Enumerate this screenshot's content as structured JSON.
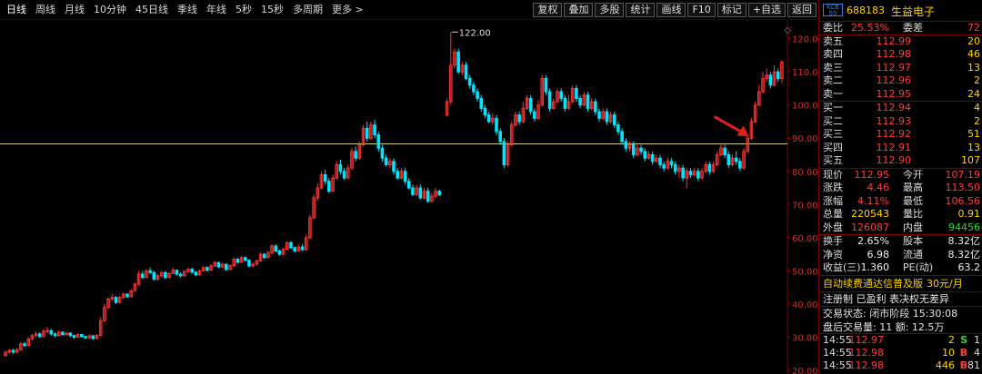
{
  "toolbar": {
    "period_tabs": [
      "日线",
      "周线",
      "月线",
      "10分钟",
      "45日线",
      "季线",
      "年线",
      "5秒",
      "15秒",
      "多周期",
      "更多 >"
    ],
    "active_tab": 0,
    "tools": [
      "复权",
      "叠加",
      "多股",
      "统计",
      "画线",
      "F10",
      "标记",
      "+自选",
      "返回"
    ]
  },
  "stock": {
    "badge": "KCB 50",
    "code": "688183",
    "name": "生益电子"
  },
  "orderbook": {
    "ratio_label": "委比",
    "ratio_value": "25.53%",
    "diff_label": "委差",
    "diff_value": "72",
    "asks": [
      {
        "label": "卖五",
        "price": "112.99",
        "vol": "20"
      },
      {
        "label": "卖四",
        "price": "112.98",
        "vol": "46"
      },
      {
        "label": "卖三",
        "price": "112.97",
        "vol": "13"
      },
      {
        "label": "卖二",
        "price": "112.96",
        "vol": "2"
      },
      {
        "label": "卖一",
        "price": "112.95",
        "vol": "24"
      }
    ],
    "bids": [
      {
        "label": "买一",
        "price": "112.94",
        "vol": "4"
      },
      {
        "label": "买二",
        "price": "112.93",
        "vol": "2"
      },
      {
        "label": "买三",
        "price": "112.92",
        "vol": "51"
      },
      {
        "label": "买四",
        "price": "112.91",
        "vol": "13"
      },
      {
        "label": "买五",
        "price": "112.90",
        "vol": "107"
      }
    ]
  },
  "quote": [
    {
      "l1": "现价",
      "v1": "112.95",
      "c1": "red",
      "l2": "今开",
      "v2": "107.19",
      "c2": "red"
    },
    {
      "l1": "涨跌",
      "v1": "4.46",
      "c1": "red",
      "l2": "最高",
      "v2": "113.50",
      "c2": "red"
    },
    {
      "l1": "涨幅",
      "v1": "4.11%",
      "c1": "red",
      "l2": "最低",
      "v2": "106.56",
      "c2": "red"
    },
    {
      "l1": "总量",
      "v1": "220543",
      "c1": "yellow",
      "l2": "量比",
      "v2": "0.91",
      "c2": "yellow"
    },
    {
      "l1": "外盘",
      "v1": "126087",
      "c1": "red",
      "l2": "内盘",
      "v2": "94456",
      "c2": "green"
    }
  ],
  "fundamentals": [
    {
      "l1": "换手",
      "v1": "2.65%",
      "l2": "股本",
      "v2": "8.32亿"
    },
    {
      "l1": "净资",
      "v1": "6.98",
      "l2": "流通",
      "v2": "8.32亿"
    },
    {
      "l1": "收益(三)",
      "v1": "1.360",
      "l2": "PE(动)",
      "v2": "63.2"
    }
  ],
  "promo": {
    "text": "自动续费通达信普及版",
    "price": "30元/月"
  },
  "reg_line": "注册制 已盈利 表决权无差异",
  "trade_status": "交易状态: 闭市阶段 15:30:08",
  "after_hours": "盘后交易量: 11 额: 12.5万",
  "ticks": [
    {
      "time": "14:55",
      "price": "112.97",
      "vol": "2",
      "bs": "S",
      "bs_color": "green",
      "cnt": "1"
    },
    {
      "time": "14:55",
      "price": "112.98",
      "vol": "10",
      "bs": "B",
      "bs_color": "red",
      "cnt": "4"
    },
    {
      "time": "14:55",
      "price": "112.98",
      "vol": "446",
      "bs": "B",
      "bs_color": "red",
      "cnt": "81"
    }
  ],
  "chart_data": {
    "type": "candlestick",
    "y_ticks": [
      "120.00",
      "110.00",
      "100.00",
      "90.00",
      "80.00",
      "70.00",
      "60.00",
      "50.00",
      "40.00",
      "30.00",
      "20.00"
    ],
    "ylim": [
      20,
      124
    ],
    "max_label": "122.00",
    "hline": 88.3,
    "up_color": "#ff3232",
    "down_color": "#00e4ff",
    "hline_color": "#d4d07a",
    "annotation": "red-arrow",
    "candles": [
      [
        24.5,
        25.5,
        24,
        25.8
      ],
      [
        25.5,
        26,
        25,
        26.5
      ],
      [
        26,
        25.5,
        25,
        26.5
      ],
      [
        25.5,
        26.2,
        25.2,
        26.8
      ],
      [
        26.2,
        28,
        26,
        28.5
      ],
      [
        28,
        27.5,
        27,
        28.6
      ],
      [
        27.5,
        29.5,
        27.2,
        30
      ],
      [
        29.5,
        30.5,
        29,
        31
      ],
      [
        30.5,
        31,
        30,
        31.8
      ],
      [
        31,
        30.2,
        29.8,
        31.5
      ],
      [
        30.2,
        31.8,
        30,
        32.5
      ],
      [
        31.8,
        32,
        31.2,
        33
      ],
      [
        32,
        31,
        30.5,
        32.4
      ],
      [
        31,
        30.5,
        30,
        31.4
      ],
      [
        30.5,
        31.5,
        30.2,
        32
      ],
      [
        31.5,
        30.8,
        30.5,
        31.8
      ],
      [
        30.8,
        31.2,
        30.5,
        31.6
      ],
      [
        31.2,
        30.5,
        30,
        31.5
      ],
      [
        30.5,
        30,
        29.5,
        30.8
      ],
      [
        30,
        30.8,
        29.8,
        31.2
      ],
      [
        30.8,
        30.2,
        29.8,
        31
      ],
      [
        30.2,
        29.8,
        29.4,
        30.5
      ],
      [
        29.8,
        30.4,
        29.5,
        30.8
      ],
      [
        30.4,
        29.6,
        29.2,
        30.6
      ],
      [
        29.6,
        30.5,
        29.4,
        30.9
      ],
      [
        30.5,
        35,
        30.2,
        36
      ],
      [
        35,
        39,
        34.5,
        40
      ],
      [
        39,
        41.5,
        38.5,
        42
      ],
      [
        41.5,
        42,
        41,
        43
      ],
      [
        42,
        40.5,
        40,
        42.4
      ],
      [
        40.5,
        42,
        40.2,
        42.6
      ],
      [
        42,
        43,
        41.5,
        43.5
      ],
      [
        43,
        42.2,
        41.8,
        43.2
      ],
      [
        42.2,
        44,
        42,
        44.5
      ],
      [
        44,
        46,
        43.8,
        46.5
      ],
      [
        46,
        49,
        45.5,
        50
      ],
      [
        49,
        48,
        47.5,
        50
      ],
      [
        48,
        50,
        47.8,
        50.5
      ],
      [
        50,
        49.5,
        49,
        51
      ],
      [
        49.5,
        47.5,
        47,
        50
      ],
      [
        47.5,
        48.5,
        47,
        49
      ],
      [
        48.5,
        49.5,
        48,
        50
      ],
      [
        49.5,
        48,
        47.6,
        50
      ],
      [
        48,
        49.2,
        47.8,
        49.6
      ],
      [
        49.2,
        50.2,
        49,
        51
      ],
      [
        50.2,
        49,
        48.6,
        50.4
      ],
      [
        49,
        48.5,
        48,
        49.5
      ],
      [
        48.5,
        49.8,
        48.2,
        50.2
      ],
      [
        49.8,
        50.5,
        49.4,
        51
      ],
      [
        50.5,
        49.6,
        49.2,
        51
      ],
      [
        49.6,
        48.8,
        48.4,
        50
      ],
      [
        48.8,
        50,
        48.6,
        50.4
      ],
      [
        50,
        51,
        49.8,
        51.5
      ],
      [
        51,
        50.2,
        49.8,
        51.4
      ],
      [
        50.2,
        51.5,
        50,
        52
      ],
      [
        51.5,
        52.5,
        51.2,
        53
      ],
      [
        52.5,
        51.2,
        50.8,
        52.8
      ],
      [
        51.2,
        52,
        50.8,
        52.4
      ],
      [
        52,
        50.4,
        50,
        52.2
      ],
      [
        50.4,
        51.6,
        50.2,
        52
      ],
      [
        51.6,
        53.5,
        51.2,
        54
      ],
      [
        53.5,
        52.6,
        52.2,
        54
      ],
      [
        52.6,
        54,
        52.4,
        54.5
      ],
      [
        54,
        53.2,
        52.8,
        54.4
      ],
      [
        53.2,
        51.5,
        51,
        53.5
      ],
      [
        51.5,
        52,
        51,
        52.6
      ],
      [
        52,
        53,
        51.6,
        53.4
      ],
      [
        53,
        55,
        52.8,
        55.5
      ],
      [
        55,
        54,
        53.6,
        55.4
      ],
      [
        54,
        55.5,
        53.8,
        56
      ],
      [
        55.5,
        57.5,
        55,
        58
      ],
      [
        57.5,
        56,
        55.6,
        58
      ],
      [
        56,
        55,
        54.6,
        56.4
      ],
      [
        55,
        56.5,
        54.8,
        57
      ],
      [
        56.5,
        58.5,
        56,
        59
      ],
      [
        58.5,
        57,
        56.6,
        59
      ],
      [
        57,
        56,
        55.5,
        57.4
      ],
      [
        56,
        57.2,
        55.8,
        57.8
      ],
      [
        57.2,
        56.4,
        56,
        58
      ],
      [
        56.4,
        60,
        56,
        61
      ],
      [
        60,
        66,
        59.5,
        67
      ],
      [
        66,
        72,
        65.5,
        73
      ],
      [
        72,
        75,
        71,
        76.5
      ],
      [
        75,
        79,
        74.5,
        80
      ],
      [
        79,
        77,
        76,
        80.5
      ],
      [
        77,
        74,
        73.5,
        78
      ],
      [
        74,
        78,
        73.8,
        79
      ],
      [
        78,
        82,
        77.5,
        83
      ],
      [
        82,
        80,
        79,
        83.5
      ],
      [
        80,
        78,
        77.5,
        81
      ],
      [
        78,
        81,
        77.8,
        82
      ],
      [
        81,
        86,
        80.5,
        87
      ],
      [
        86,
        84,
        83,
        87.5
      ],
      [
        84,
        88,
        83.5,
        89
      ],
      [
        88,
        93,
        87.5,
        94
      ],
      [
        93,
        90,
        89,
        95
      ],
      [
        90,
        94,
        89.5,
        95
      ],
      [
        94,
        91,
        90,
        95.5
      ],
      [
        91,
        87,
        86,
        92
      ],
      [
        87,
        84,
        83,
        88
      ],
      [
        84,
        82,
        81.5,
        85
      ],
      [
        82,
        83,
        81,
        84
      ],
      [
        83,
        80,
        79,
        84
      ],
      [
        80,
        78,
        77.5,
        81
      ],
      [
        78,
        80,
        77.5,
        81
      ],
      [
        80,
        77,
        76,
        81
      ],
      [
        77,
        75,
        74.5,
        78
      ],
      [
        75,
        73,
        72.5,
        76
      ],
      [
        73,
        75,
        72.5,
        76
      ],
      [
        75,
        72,
        71.5,
        76
      ],
      [
        72,
        74,
        71.5,
        75
      ],
      [
        74,
        71,
        70.5,
        75
      ],
      [
        71,
        72.5,
        70.5,
        73.5
      ],
      [
        72.5,
        74,
        72,
        75
      ],
      [
        74,
        73,
        72.5,
        74.5
      ],
      [
        null,
        null,
        null,
        null
      ],
      [
        97,
        101,
        96.5,
        102
      ],
      [
        101,
        112,
        100,
        122
      ],
      [
        112,
        116,
        111,
        117
      ],
      [
        116,
        110,
        109.5,
        117
      ],
      [
        110,
        112,
        109,
        113
      ],
      [
        112,
        108,
        107.5,
        113
      ],
      [
        108,
        106,
        105,
        109
      ],
      [
        106,
        104,
        103,
        107
      ],
      [
        104,
        102,
        101,
        105
      ],
      [
        102,
        99,
        98,
        103
      ],
      [
        99,
        97,
        96,
        100
      ],
      [
        97,
        95,
        94.5,
        98
      ],
      [
        95,
        96,
        94,
        97.5
      ],
      [
        96,
        92,
        91,
        97
      ],
      [
        92,
        89,
        88,
        93
      ],
      [
        89,
        82,
        81,
        90
      ],
      [
        82,
        88,
        81.5,
        89
      ],
      [
        88,
        94,
        87.5,
        95
      ],
      [
        94,
        97,
        93.5,
        98
      ],
      [
        97,
        95,
        94,
        98
      ],
      [
        95,
        99,
        94.5,
        101
      ],
      [
        99,
        102,
        98.5,
        103
      ],
      [
        102,
        98,
        97,
        103
      ],
      [
        98,
        96,
        95,
        99
      ],
      [
        96,
        100,
        95.5,
        101.5
      ],
      [
        100,
        108,
        99.5,
        109
      ],
      [
        108,
        104,
        103,
        109
      ],
      [
        104,
        99,
        98,
        105
      ],
      [
        99,
        101,
        98.5,
        102
      ],
      [
        101,
        104,
        100.5,
        105
      ],
      [
        104,
        102,
        101,
        105
      ],
      [
        102,
        99,
        98,
        103
      ],
      [
        99,
        101,
        98.5,
        103
      ],
      [
        101,
        105,
        100.5,
        106
      ],
      [
        105,
        102,
        101,
        106
      ],
      [
        102,
        100,
        99,
        103
      ],
      [
        100,
        103,
        99.5,
        104
      ],
      [
        103,
        99,
        98,
        104
      ],
      [
        99,
        101,
        98.5,
        102
      ],
      [
        101,
        98,
        97,
        102
      ],
      [
        98,
        96,
        95,
        99
      ],
      [
        96,
        98,
        95.5,
        99
      ],
      [
        98,
        95,
        94,
        99
      ],
      [
        95,
        97,
        94.5,
        98
      ],
      [
        97,
        94,
        93,
        98
      ],
      [
        94,
        92,
        91,
        95
      ],
      [
        92,
        89,
        88,
        93
      ],
      [
        89,
        87,
        86,
        90
      ],
      [
        87,
        88,
        86,
        89
      ],
      [
        88,
        85,
        84,
        89
      ],
      [
        85,
        87,
        84.5,
        88
      ],
      [
        87,
        86,
        85,
        88
      ],
      [
        86,
        84,
        83,
        87
      ],
      [
        84,
        85,
        83.5,
        86
      ],
      [
        85,
        83,
        82,
        86
      ],
      [
        83,
        84,
        82.5,
        85
      ],
      [
        84,
        82,
        81,
        85
      ],
      [
        82,
        81,
        80,
        83
      ],
      [
        81,
        83,
        80.5,
        84
      ],
      [
        83,
        82,
        81,
        84
      ],
      [
        82,
        80,
        79,
        83
      ],
      [
        80,
        81,
        78,
        82
      ],
      [
        81,
        78,
        77,
        82
      ],
      [
        78,
        80,
        75,
        81
      ],
      [
        80,
        79,
        78,
        81
      ],
      [
        79,
        80,
        78.5,
        81
      ],
      [
        80,
        78,
        77,
        81
      ],
      [
        78,
        80,
        77.5,
        81
      ],
      [
        80,
        82,
        79.5,
        83
      ],
      [
        82,
        80,
        79,
        83
      ],
      [
        80,
        82,
        79.5,
        83
      ],
      [
        82,
        85,
        81.5,
        86
      ],
      [
        85,
        87,
        84.5,
        88
      ],
      [
        87,
        85,
        84,
        88
      ],
      [
        85,
        82,
        81,
        86
      ],
      [
        82,
        84,
        81.5,
        85
      ],
      [
        84,
        83,
        82,
        86
      ],
      [
        83,
        81,
        80,
        84
      ],
      [
        81,
        86,
        80.5,
        87
      ],
      [
        86,
        90,
        85.5,
        91
      ],
      [
        90,
        95,
        89.5,
        96
      ],
      [
        95,
        100,
        94.5,
        101
      ],
      [
        100,
        104,
        99.5,
        106
      ],
      [
        104,
        108,
        103.5,
        110
      ],
      [
        108,
        109,
        107,
        111
      ],
      [
        109,
        106,
        105,
        110
      ],
      [
        106,
        110,
        105.5,
        112
      ],
      [
        110,
        108,
        107,
        111
      ],
      [
        108,
        112.95,
        106.56,
        113.5
      ]
    ]
  }
}
